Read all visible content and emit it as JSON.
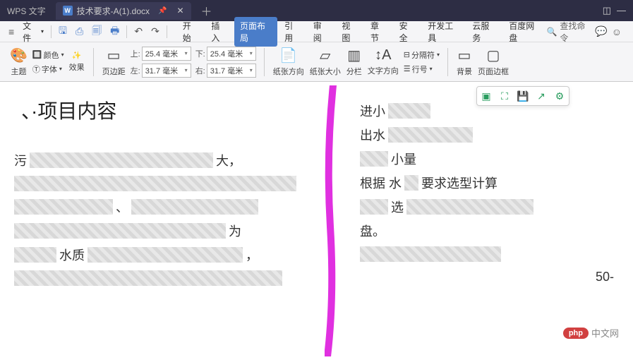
{
  "titlebar": {
    "app_name": "WPS 文字",
    "tab_name": "技术要求-A(1).docx",
    "tab_icon": "W"
  },
  "menubar": {
    "file_label": "文件",
    "ribbon_tabs": [
      "开始",
      "插入",
      "页面布局",
      "引用",
      "审阅",
      "视图",
      "章节",
      "安全",
      "开发工具",
      "云服务",
      "百度网盘"
    ],
    "active_tab": "页面布局",
    "search_placeholder": "查找命令"
  },
  "ribbon": {
    "theme": {
      "label": "主题",
      "colors_label": "颜色",
      "fonts_label": "字体",
      "effects_label": "效果"
    },
    "margins": {
      "button_label": "页边距",
      "top_label": "上:",
      "top_value": "25.4 毫米",
      "bottom_label": "下:",
      "bottom_value": "25.4 毫米",
      "left_label": "左:",
      "left_value": "31.7 毫米",
      "right_label": "右:",
      "right_value": "31.7 毫米"
    },
    "orientation_label": "纸张方向",
    "size_label": "纸张大小",
    "columns_label": "分栏",
    "text_direction_label": "文字方向",
    "line_numbers_label": "行号",
    "separator_label": "分隔符",
    "background_label": "背景",
    "page_border_label": "页面边框"
  },
  "document": {
    "title": "、·项目内容",
    "left_fragments": [
      "污",
      "大，",
      "、",
      "为",
      "水质",
      "，"
    ],
    "right_fragments": [
      "进小",
      "出水",
      "小量",
      "根据 水",
      "要求选型计算",
      "选",
      "盘。",
      "50-"
    ]
  },
  "watermark": {
    "badge": "php",
    "text": "中文网"
  }
}
